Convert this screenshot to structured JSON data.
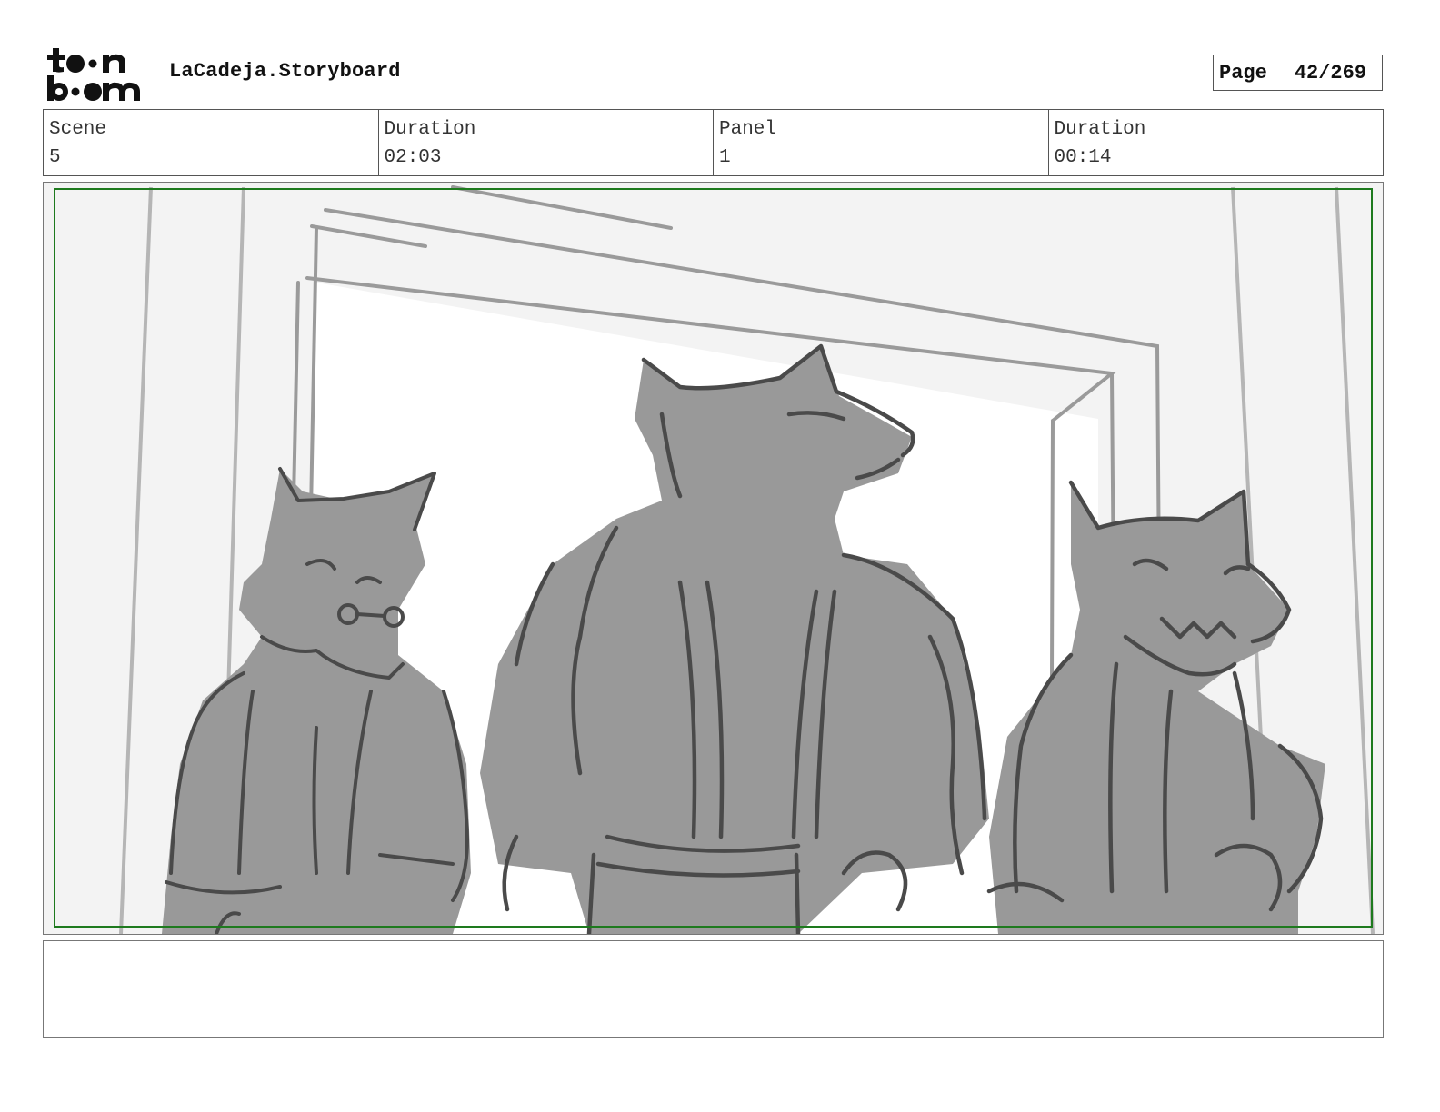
{
  "header": {
    "logo_text": "toon boom",
    "title": "LaCadeja.Storyboard",
    "page_label": "Page",
    "page_number": "42/269"
  },
  "info": [
    {
      "label": "Scene",
      "value": "5"
    },
    {
      "label": "Duration",
      "value": "02:03"
    },
    {
      "label": "Panel",
      "value": "1"
    },
    {
      "label": "Duration",
      "value": "00:14"
    }
  ],
  "panel": {
    "safe_frame_color": "#1e7a1e",
    "fill_color": "#999999",
    "line_color": "#4a4a4a",
    "background_color": "#f3f3f3"
  },
  "notes": {
    "text": ""
  }
}
